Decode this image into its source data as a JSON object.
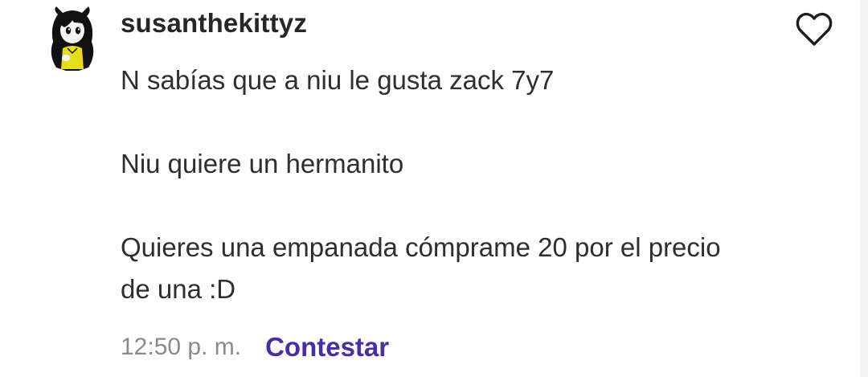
{
  "comment": {
    "username": "susanthekittyz",
    "paragraphs": [
      "N sabías que a niu le gusta zack 7y7",
      "Niu quiere un hermanito",
      "Quieres una empanada cómprame 20 por el precio de una :D"
    ],
    "timestamp": "12:50 p. m.",
    "reply_label": "Contestar",
    "like_icon": "heart-outline-icon",
    "avatar_icon": "cartoon-cat-avatar"
  },
  "colors": {
    "reply_link": "#4a2da6",
    "timestamp": "#8a8a8a",
    "username": "#262626",
    "background": "#ffffff"
  }
}
